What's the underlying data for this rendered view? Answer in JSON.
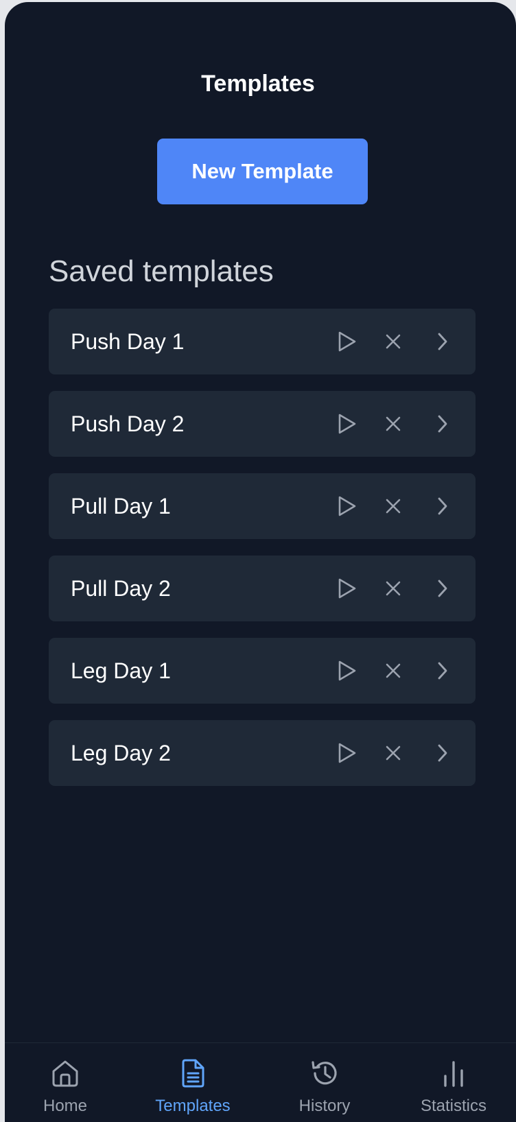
{
  "header": {
    "title": "Templates"
  },
  "actions": {
    "new_template_label": "New Template"
  },
  "section": {
    "title": "Saved templates"
  },
  "templates": [
    {
      "name": "Push Day 1"
    },
    {
      "name": "Push Day 2"
    },
    {
      "name": "Pull Day 1"
    },
    {
      "name": "Pull Day 2"
    },
    {
      "name": "Leg Day 1"
    },
    {
      "name": "Leg Day 2"
    }
  ],
  "template_row_icons": [
    "play-icon",
    "close-icon",
    "chevron-right-icon"
  ],
  "bottom_nav": {
    "items": [
      {
        "label": "Home",
        "icon": "home-icon",
        "active": false
      },
      {
        "label": "Templates",
        "icon": "document-icon",
        "active": true
      },
      {
        "label": "History",
        "icon": "history-icon",
        "active": false
      },
      {
        "label": "Statistics",
        "icon": "bar-chart-icon",
        "active": false
      }
    ]
  },
  "colors": {
    "background": "#111827",
    "card": "#1f2937",
    "accent": "#4f86f7",
    "active_nav": "#60a5fa",
    "muted": "#9ca3af"
  }
}
